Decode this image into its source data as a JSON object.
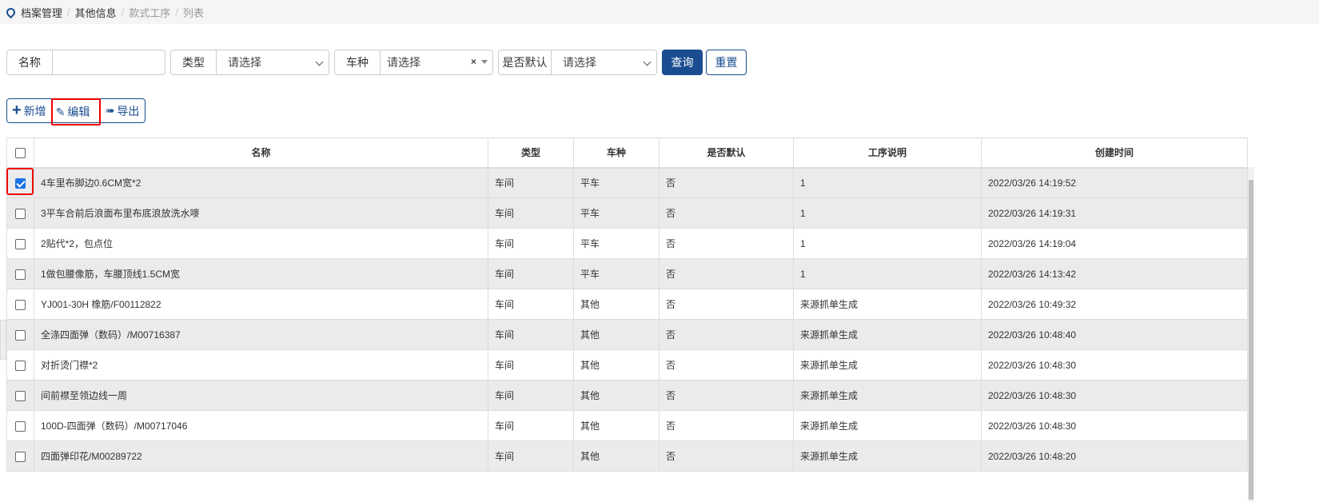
{
  "breadcrumb": [
    "档案管理",
    "其他信息",
    "款式工序",
    "列表"
  ],
  "filters": {
    "name_label": "名称",
    "name_value": "",
    "type_label": "类型",
    "type_value": "请选择",
    "car_label": "车种",
    "car_value": "请选择",
    "clear": "×",
    "default_label": "是否默认",
    "default_value": "请选择",
    "search": "查询",
    "reset": "重置"
  },
  "toolbar": {
    "add": "新增",
    "edit": "编辑",
    "export": "导出"
  },
  "table": {
    "headers": [
      "名称",
      "类型",
      "车种",
      "是否默认",
      "工序说明",
      "创建时间"
    ],
    "rows": [
      {
        "checked": true,
        "c": [
          "4车里布脚边0.6CM宽*2",
          "车间",
          "平车",
          "否",
          "1",
          "2022/03/26 14:19:52"
        ]
      },
      {
        "checked": false,
        "c": [
          "3平车合前后浪面布里布底浪放洗水嘜",
          "车间",
          "平车",
          "否",
          "1",
          "2022/03/26 14:19:31"
        ]
      },
      {
        "checked": false,
        "c": [
          "2贴代*2，包点位",
          "车间",
          "平车",
          "否",
          "1",
          "2022/03/26 14:19:04"
        ]
      },
      {
        "checked": false,
        "c": [
          "1做包腰像筋，车腰顶线1.5CM宽",
          "车间",
          "平车",
          "否",
          "1",
          "2022/03/26 14:13:42"
        ]
      },
      {
        "checked": false,
        "c": [
          "YJ001-30H 橡筋/F00112822",
          "车间",
          "其他",
          "否",
          "来源抓单生成",
          "2022/03/26 10:49:32"
        ]
      },
      {
        "checked": false,
        "c": [
          "全涤四面弹（数码）/M00716387",
          "车间",
          "其他",
          "否",
          "来源抓单生成",
          "2022/03/26 10:48:40"
        ]
      },
      {
        "checked": false,
        "c": [
          "对折烫门襟*2",
          "车间",
          "其他",
          "否",
          "来源抓单生成",
          "2022/03/26 10:48:30"
        ]
      },
      {
        "checked": false,
        "c": [
          "间前襟至领边线一周",
          "车间",
          "其他",
          "否",
          "来源抓单生成",
          "2022/03/26 10:48:30"
        ]
      },
      {
        "checked": false,
        "c": [
          "100D-四面弹（数码）/M00717046",
          "车间",
          "其他",
          "否",
          "来源抓单生成",
          "2022/03/26 10:48:30"
        ]
      },
      {
        "checked": false,
        "c": [
          "四面弹印花/M00289722",
          "车间",
          "其他",
          "否",
          "来源抓单生成",
          "2022/03/26 10:48:20"
        ]
      }
    ]
  }
}
